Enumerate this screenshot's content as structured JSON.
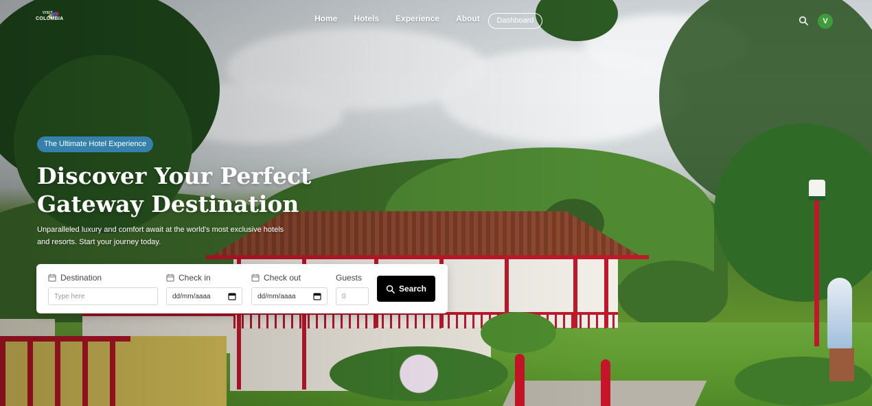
{
  "brand": {
    "logo_small": "VISIT",
    "logo_text": "COLOMBIA"
  },
  "nav": {
    "items": [
      {
        "label": "Home"
      },
      {
        "label": "Hotels"
      },
      {
        "label": "Experience"
      },
      {
        "label": "About"
      }
    ],
    "dashboard_label": "Dashboard",
    "avatar_initial": "V"
  },
  "hero": {
    "tagline": "The Ultimate Hotel Experience",
    "headline_line1": "Discover Your Perfect",
    "headline_line2": "Gateway Destination",
    "subtext": "Unparalleled luxury and comfort await at the world's most exclusive hotels and resorts. Start your journey today."
  },
  "search": {
    "destination": {
      "label": "Destination",
      "placeholder": "Type here"
    },
    "checkin": {
      "label": "Check in",
      "value": "dd/mm/aaaa"
    },
    "checkout": {
      "label": "Check out",
      "value": "dd/mm/aaaa"
    },
    "guests": {
      "label": "Guests",
      "value": "0"
    },
    "button_label": "Search"
  },
  "colors": {
    "pill_bg": "#388cc8",
    "avatar_bg": "#3f9c3a",
    "search_button_bg": "#000000",
    "accent_red": "#c0182b"
  },
  "icons": {
    "header_search": "search-icon",
    "field": "calendar-icon",
    "button": "search-icon"
  }
}
